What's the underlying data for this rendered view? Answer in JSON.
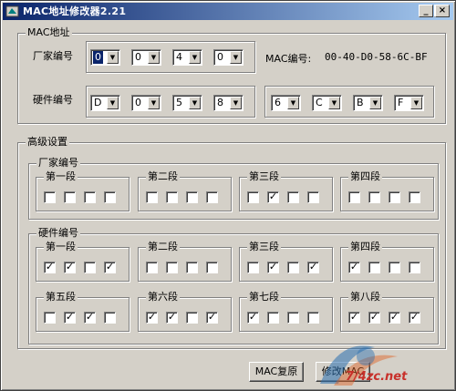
{
  "window": {
    "title": "MAC地址修改器2.21"
  },
  "caption_buttons": {
    "minimize": "_",
    "maximize": "□",
    "close": "×"
  },
  "mac_section": {
    "title": "MAC地址",
    "vendor_label": "厂家编号",
    "hardware_label": "硬件编号",
    "mac_number_label": "MAC编号:",
    "mac_number_value": "00-40-D0-58-6C-BF",
    "vendor_values": [
      "0",
      "0",
      "4",
      "0"
    ],
    "hardware_values": [
      "D",
      "0",
      "5",
      "8",
      "6",
      "C",
      "B",
      "F"
    ]
  },
  "advanced": {
    "title": "高级设置",
    "vendor_group": {
      "title": "厂家编号",
      "segments": [
        {
          "label": "第一段",
          "checks": [
            false,
            false,
            false,
            false
          ]
        },
        {
          "label": "第二段",
          "checks": [
            false,
            false,
            false,
            false
          ]
        },
        {
          "label": "第三段",
          "checks": [
            false,
            true,
            false,
            false
          ]
        },
        {
          "label": "第四段",
          "checks": [
            false,
            false,
            false,
            false
          ]
        }
      ]
    },
    "hardware_group": {
      "title": "硬件编号",
      "segments": [
        {
          "label": "第一段",
          "checks": [
            true,
            true,
            false,
            true
          ]
        },
        {
          "label": "第二段",
          "checks": [
            false,
            false,
            false,
            false
          ]
        },
        {
          "label": "第三段",
          "checks": [
            false,
            true,
            false,
            true
          ]
        },
        {
          "label": "第四段",
          "checks": [
            true,
            false,
            false,
            false
          ]
        },
        {
          "label": "第五段",
          "checks": [
            false,
            true,
            true,
            false
          ]
        },
        {
          "label": "第六段",
          "checks": [
            true,
            true,
            false,
            true
          ]
        },
        {
          "label": "第七段",
          "checks": [
            true,
            false,
            false,
            false
          ]
        },
        {
          "label": "第八段",
          "checks": [
            true,
            true,
            true,
            true
          ]
        }
      ]
    }
  },
  "buttons": {
    "restore": "MAC复原",
    "modify": "修改MAC"
  },
  "watermark": {
    "text": "7/4zc.net"
  },
  "colors": {
    "face": "#d4d0c8",
    "title_start": "#0a246a",
    "title_end": "#a6caf0"
  }
}
